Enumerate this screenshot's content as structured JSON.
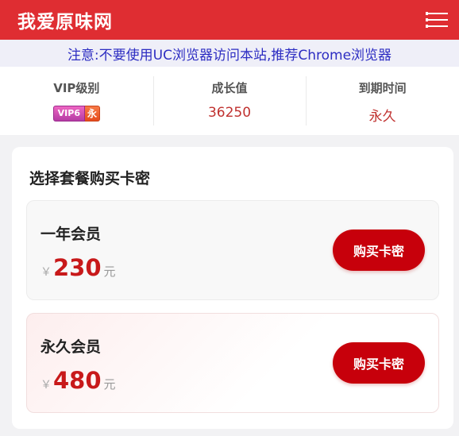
{
  "header": {
    "site_title": "我爱原味网",
    "menu_icon": "menu-icon"
  },
  "notice": {
    "text": "注意:不要使用UC浏览器访问本站,推荐Chrome浏览器"
  },
  "stats": {
    "vip_label": "VIP级别",
    "vip_badge": "VIP6",
    "forever_badge": "永",
    "growth_label": "成长值",
    "growth_value": "36250",
    "expire_label": "到期时间",
    "expire_value": "永久"
  },
  "panel": {
    "title": "选择套餐购买卡密",
    "plans": [
      {
        "name": "一年会员",
        "currency": "￥",
        "amount": "230",
        "unit": "元",
        "button_label": "购买卡密"
      },
      {
        "name": "永久会员",
        "currency": "￥",
        "amount": "480",
        "unit": "元",
        "button_label": "购买卡密"
      }
    ]
  },
  "colors": {
    "header_bg": "#df2d32",
    "notice_text": "#2d2dc2",
    "price": "#c8191a",
    "button": "#c7000b"
  }
}
